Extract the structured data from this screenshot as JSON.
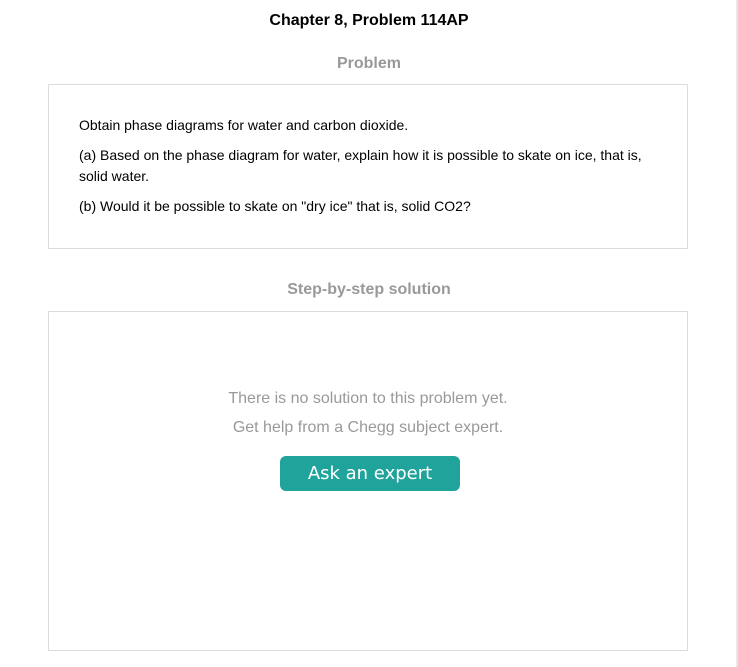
{
  "header": {
    "title": "Chapter 8, Problem 114AP"
  },
  "problem": {
    "heading": "Problem",
    "lines": [
      "Obtain phase diagrams for water and carbon dioxide.",
      "(a) Based on the phase diagram for water, explain how it is possible to skate on ice, that is, solid water.",
      "(b) Would it be possible to skate on \"dry ice\" that is, solid CO2?"
    ]
  },
  "solution": {
    "heading": "Step-by-step solution",
    "empty_message": "There is no solution to this problem yet.",
    "help_message": "Get help from a Chegg subject expert.",
    "button_label": "Ask an expert"
  },
  "colors": {
    "accent": "#20a39b",
    "heading_gray": "#999999",
    "border": "#dcdcdc"
  }
}
